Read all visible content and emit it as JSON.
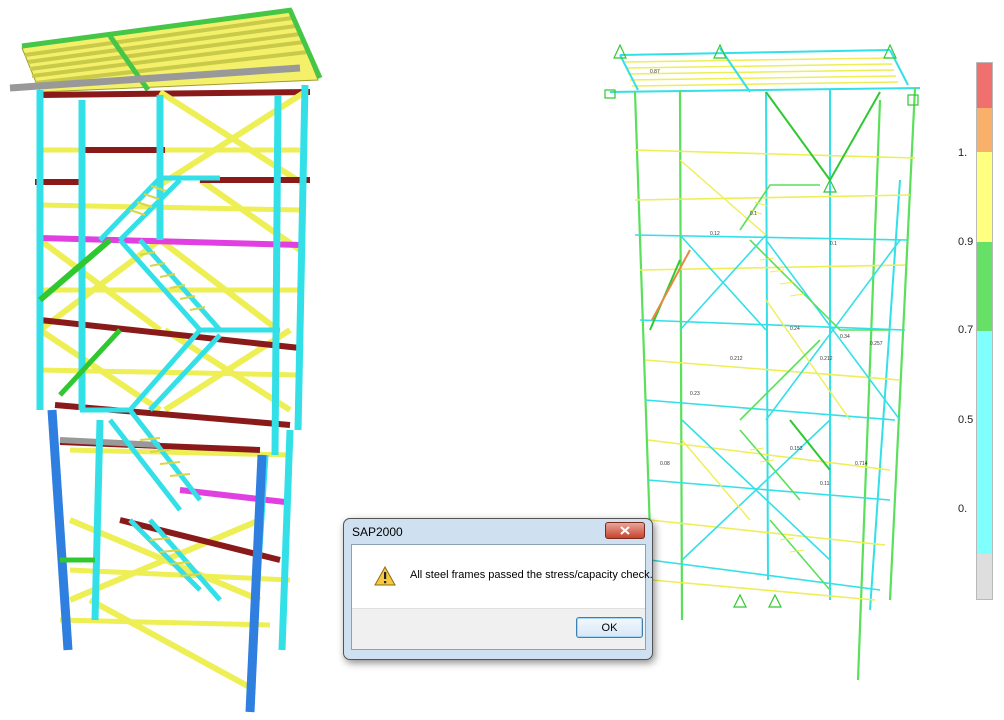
{
  "dialog": {
    "title": "SAP2000",
    "message": "All steel frames passed the stress/capacity check.",
    "ok_label": "OK",
    "close_glyph": "x",
    "icon": "warning-icon"
  },
  "ratio_scale": {
    "labels": [
      "1.",
      "0.9",
      "0.7",
      "0.5",
      "0."
    ],
    "bands": [
      {
        "from": 1.0,
        "to": 1.1,
        "color": "#f07070"
      },
      {
        "from": 0.9,
        "to": 1.0,
        "color": "#f8b06a"
      },
      {
        "from": 0.7,
        "to": 0.9,
        "color": "#ffff80"
      },
      {
        "from": 0.5,
        "to": 0.7,
        "color": "#66e066"
      },
      {
        "from": 0.0,
        "to": 0.5,
        "color": "#80ffff"
      },
      {
        "from": -0.1,
        "to": 0.0,
        "color": "#dedede"
      }
    ]
  },
  "member_ratio_labels": [
    "0.87",
    "0.1",
    "0.24",
    "0.34",
    "0.212",
    "0.257",
    "0.714",
    "0.11",
    "0.12",
    "0.212",
    "0.23",
    "0.153",
    "0.1",
    "0.08"
  ],
  "colors": {
    "column": "#33e0e8",
    "brace": "#eeee55",
    "beam_dark": "#8a1a1a",
    "beam_magenta": "#e040e0",
    "beam_grey": "#999999",
    "column_blue": "#2f7fe0",
    "green": "#30c830"
  }
}
